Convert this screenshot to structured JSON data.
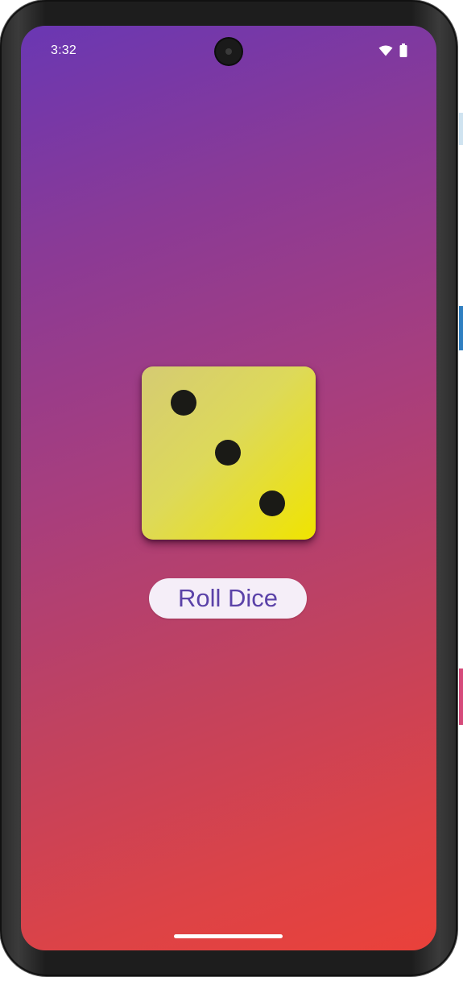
{
  "status_bar": {
    "time": "3:32",
    "icons": [
      "wifi-icon",
      "battery-icon"
    ]
  },
  "dice": {
    "face_value": 3,
    "face_color": "#e6dd40",
    "pip_color": "#1a1a16"
  },
  "roll_button": {
    "label": "Roll Dice",
    "text_color": "#5b42a8",
    "background": "#f5eef8"
  },
  "theme": {
    "gradient_start": "#6a37b3",
    "gradient_end": "#ea413a"
  }
}
